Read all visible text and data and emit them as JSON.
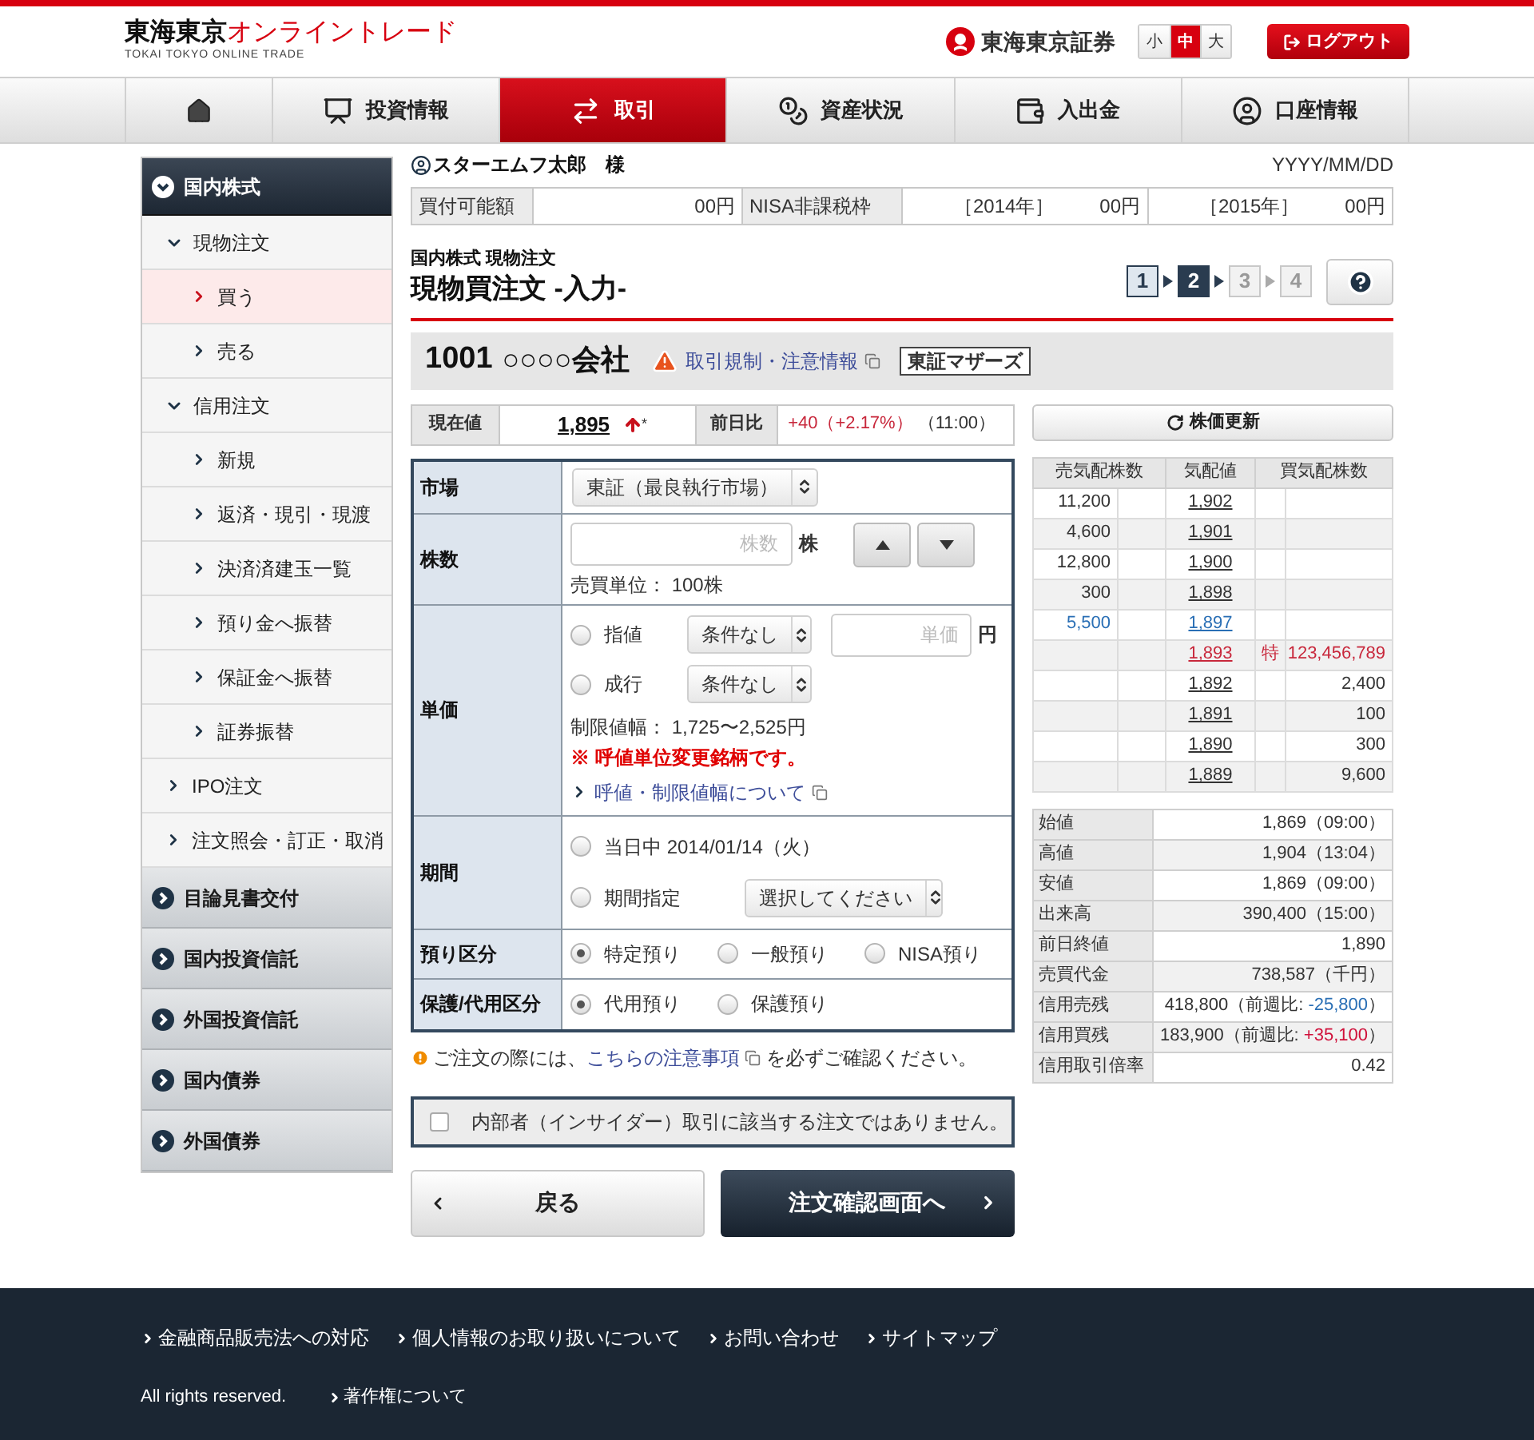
{
  "header": {
    "logo_main": "東海東京",
    "logo_accent": "オンライントレード",
    "logo_sub": "TOKAI TOKYO ONLINE TRADE",
    "brand": "東海東京証券",
    "font_sizes": [
      {
        "label": "小",
        "selected": false
      },
      {
        "label": "中",
        "selected": true
      },
      {
        "label": "大",
        "selected": false
      }
    ],
    "logout": "ログアウト"
  },
  "nav": [
    {
      "kind": "home",
      "selected": false
    },
    {
      "label": "投資情報",
      "selected": false
    },
    {
      "label": "取引",
      "selected": true
    },
    {
      "label": "資産状況",
      "selected": false
    },
    {
      "label": "入出金",
      "selected": false
    },
    {
      "label": "口座情報",
      "selected": false
    }
  ],
  "sidebar": [
    {
      "label": "国内株式",
      "expanded": true,
      "children": [
        {
          "label": "現物注文",
          "expanded": true,
          "children": [
            {
              "label": "買う",
              "selected": true
            },
            {
              "label": "売る",
              "selected": false
            }
          ]
        },
        {
          "label": "信用注文",
          "expanded": true,
          "children": [
            {
              "label": "新規",
              "selected": false
            },
            {
              "label": "返済・現引・現渡",
              "selected": false
            },
            {
              "label": "決済済建玉一覧",
              "selected": false
            },
            {
              "label": "預り金へ振替",
              "selected": false
            },
            {
              "label": "保証金へ振替",
              "selected": false
            },
            {
              "label": "証券振替",
              "selected": false
            }
          ]
        },
        {
          "label": "IPO注文",
          "selected": false
        },
        {
          "label": "注文照会・訂正・取消",
          "selected": false
        }
      ]
    },
    {
      "label": "目論見書交付",
      "expanded": false
    },
    {
      "label": "国内投資信託",
      "expanded": false
    },
    {
      "label": "外国投資信託",
      "expanded": false
    },
    {
      "label": "国内債券",
      "expanded": false
    },
    {
      "label": "外国債券",
      "expanded": false
    }
  ],
  "user": {
    "name": "スターエムフ太郎",
    "honorific": "様",
    "date": "YYYY/MM/DD"
  },
  "balance": {
    "label": "買付可能額",
    "value": "00円",
    "nisa_label": "NISA非課税枠",
    "years": [
      {
        "year": "［2014年］",
        "value": "00円"
      },
      {
        "year": "［2015年］",
        "value": "00円"
      }
    ]
  },
  "page": {
    "breadcrumb": "国内株式 現物注文",
    "title": "現物買注文 -入力-",
    "steps": [
      {
        "label": "1",
        "kind": "done"
      },
      {
        "label": "2",
        "kind": "current"
      },
      {
        "label": "3",
        "kind": "pending"
      },
      {
        "label": "4",
        "kind": "pending"
      }
    ]
  },
  "stock": {
    "code": "1001",
    "name": "○○○○会社",
    "warning_link": "取引規制・注意情報",
    "market": "東証マザーズ"
  },
  "quote": {
    "price_label": "現在値",
    "price": "1,895",
    "mark": "*",
    "change_label": "前日比",
    "change": "+40（+2.17%）",
    "time": "（11:00）",
    "refresh": "株価更新"
  },
  "form": {
    "market": {
      "label": "市場",
      "select": "東証（最良執行市場）"
    },
    "shares": {
      "label": "株数",
      "placeholder": "株数",
      "unit": "株",
      "note": "売買単位： 100株"
    },
    "price": {
      "label": "単価",
      "options": [
        {
          "label": "指値",
          "selected": false,
          "condition": "条件なし",
          "placeholder": "単価",
          "unit": "円"
        },
        {
          "label": "成行",
          "selected": false,
          "condition": "条件なし"
        }
      ],
      "range": "制限値幅： 1,725〜2,525円",
      "warning": "※ 呼値単位変更銘柄です。",
      "link": "呼値・制限値幅について"
    },
    "period": {
      "label": "期間",
      "options": [
        {
          "label": "当日中 2014/01/14（火）",
          "selected": false
        },
        {
          "label": "期間指定",
          "selected": false,
          "select": "選択してください"
        }
      ]
    },
    "account": {
      "label": "預り区分",
      "options": [
        {
          "label": "特定預り",
          "selected": true
        },
        {
          "label": "一般預り",
          "selected": false
        },
        {
          "label": "NISA預り",
          "selected": false
        }
      ]
    },
    "custody": {
      "label": "保護/代用区分",
      "options": [
        {
          "label": "代用預り",
          "selected": true
        },
        {
          "label": "保護預り",
          "selected": false
        }
      ]
    }
  },
  "notice": {
    "before": "ご注文の際には、",
    "link": "こちらの注意事項",
    "after": "を必ずご確認ください。"
  },
  "insider": {
    "label": "内部者（インサイダー）取引に該当する注文ではありません。",
    "checked": false
  },
  "buttons": {
    "back": "戻る",
    "next": "注文確認画面へ"
  },
  "board": {
    "columns": [
      "売気配株数",
      "気配値",
      "買気配株数"
    ],
    "rows": [
      {
        "kind": "ask",
        "sell": "11,200",
        "price": "1,902"
      },
      {
        "kind": "ask",
        "sell": "4,600",
        "price": "1,901"
      },
      {
        "kind": "ask",
        "sell": "12,800",
        "price": "1,900"
      },
      {
        "kind": "ask",
        "sell": "300",
        "price": "1,898"
      },
      {
        "kind": "best_ask",
        "sell": "5,500",
        "price": "1,897"
      },
      {
        "kind": "special",
        "price": "1,893",
        "flag": "特",
        "buy": "123,456,789"
      },
      {
        "kind": "bid",
        "price": "1,892",
        "buy": "2,400"
      },
      {
        "kind": "bid",
        "price": "1,891",
        "buy": "100"
      },
      {
        "kind": "bid",
        "price": "1,890",
        "buy": "300"
      },
      {
        "kind": "bid",
        "price": "1,889",
        "buy": "9,600"
      }
    ]
  },
  "stats": [
    {
      "label": "始値",
      "value": "1,869（09:00）"
    },
    {
      "label": "高値",
      "value": "1,904（13:04）"
    },
    {
      "label": "安値",
      "value": "1,869（09:00）"
    },
    {
      "label": "出来高",
      "value": "390,400（15:00）"
    },
    {
      "label": "前日終値",
      "value": "1,890"
    },
    {
      "label": "売買代金",
      "value": "738,587（千円）"
    },
    {
      "label": "信用売残",
      "value": "418,800（前週比: ",
      "change": "-25,800",
      "kind": "down",
      "suffix": "）"
    },
    {
      "label": "信用買残",
      "value": "183,900（前週比: ",
      "change": "+35,100",
      "kind": "up",
      "suffix": "）"
    },
    {
      "label": "信用取引倍率",
      "value": "0.42"
    }
  ],
  "footer": {
    "links": [
      "金融商品販売法への対応",
      "個人情報のお取り扱いについて",
      "お問い合わせ",
      "サイトマップ"
    ],
    "copyright": "All rights reserved.",
    "copyright_link": "著作権について"
  }
}
